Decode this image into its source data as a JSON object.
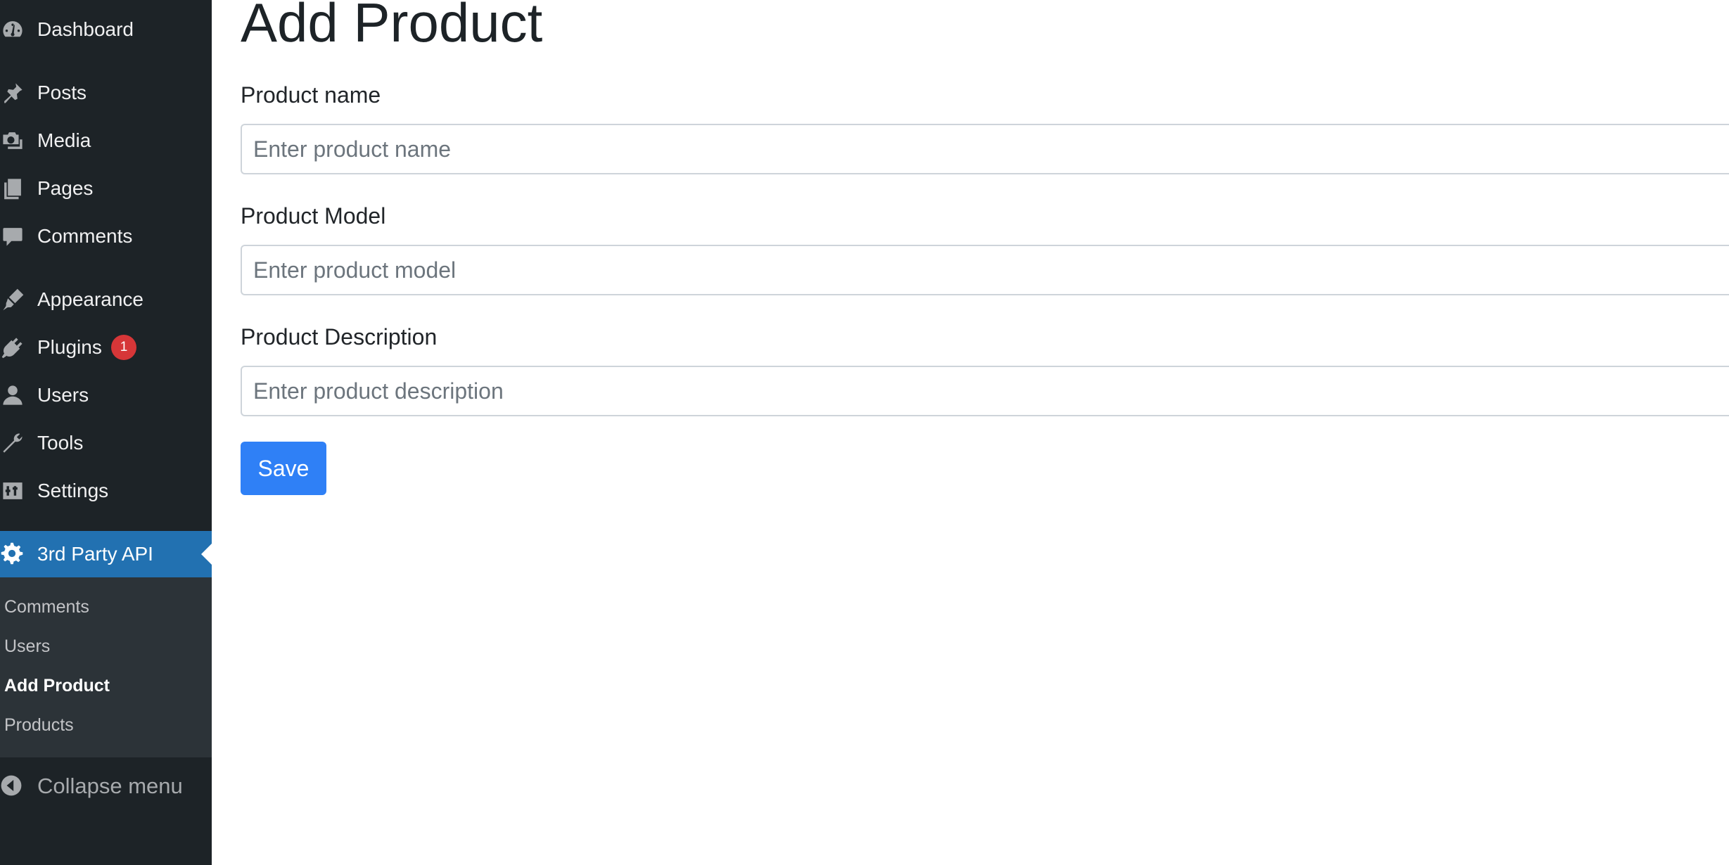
{
  "sidebar": {
    "items": [
      {
        "label": "Dashboard",
        "icon": "dashboard-icon"
      },
      {
        "label": "Posts",
        "icon": "pin-icon"
      },
      {
        "label": "Media",
        "icon": "media-icon"
      },
      {
        "label": "Pages",
        "icon": "pages-icon"
      },
      {
        "label": "Comments",
        "icon": "comment-icon"
      },
      {
        "label": "Appearance",
        "icon": "brush-icon"
      },
      {
        "label": "Plugins",
        "icon": "plugin-icon",
        "badge": "1"
      },
      {
        "label": "Users",
        "icon": "user-icon"
      },
      {
        "label": "Tools",
        "icon": "wrench-icon"
      },
      {
        "label": "Settings",
        "icon": "settings-icon"
      }
    ],
    "active": {
      "label": "3rd Party API",
      "icon": "gear-icon"
    },
    "submenu": [
      {
        "label": "Comments"
      },
      {
        "label": "Users"
      },
      {
        "label": "Add Product",
        "current": true
      },
      {
        "label": "Products"
      }
    ],
    "collapse_label": "Collapse menu"
  },
  "main": {
    "title": "Add Product",
    "fields": [
      {
        "label": "Product name",
        "placeholder": "Enter product name",
        "value": ""
      },
      {
        "label": "Product Model",
        "placeholder": "Enter product model",
        "value": ""
      },
      {
        "label": "Product Description",
        "placeholder": "Enter product description",
        "value": ""
      }
    ],
    "save_label": "Save"
  },
  "colors": {
    "sidebar_bg": "#1d2327",
    "active_bg": "#2271b1",
    "submenu_bg": "#2c3338",
    "badge": "#d63638",
    "button": "#2f80f6"
  }
}
